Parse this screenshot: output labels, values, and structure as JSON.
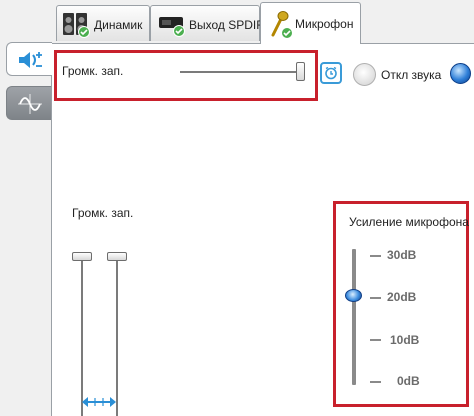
{
  "tabs": [
    {
      "label": "Динамик",
      "icon": "speaker-icon",
      "active": false
    },
    {
      "label": "Выход SPDIF",
      "icon": "spdif-icon",
      "active": false
    },
    {
      "label": "Микрофон",
      "icon": "microphone-icon",
      "active": true
    }
  ],
  "sidebar": [
    {
      "icon": "mic-volume-icon",
      "selected": true
    },
    {
      "icon": "waveform-icon",
      "selected": false
    }
  ],
  "record": {
    "label": "Громк. зап.",
    "level": 1.0
  },
  "mute": {
    "label": "Откл звука",
    "checked": false
  },
  "record_level": {
    "label": "Громк. зап.",
    "left_level": 1.0,
    "right_level": 1.0,
    "link_icon": "link-channels-icon"
  },
  "boost": {
    "title": "Усиление микрофона",
    "ticks": [
      "30dB",
      "20dB",
      "10dB",
      "0dB"
    ],
    "selected": "20dB"
  },
  "colors": {
    "highlight": "#c8202c",
    "accent": "#3a9bd8",
    "check": "#4caf50"
  }
}
